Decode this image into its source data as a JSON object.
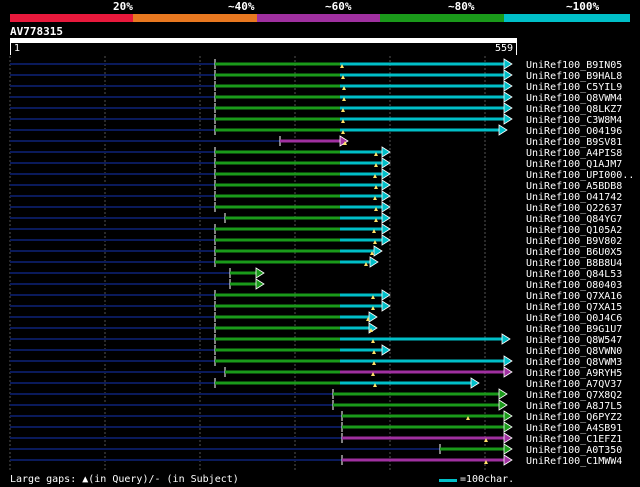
{
  "legend": {
    "colors": [
      "#e8193c",
      "#e87820",
      "#a030a0",
      "#1a9a1a",
      "#00bfc8"
    ],
    "labels": [
      "20%",
      "~40%",
      "~60%",
      "~80%",
      "~100%"
    ]
  },
  "query": {
    "id": "AV778315",
    "start": "1",
    "end": "559"
  },
  "hits": [
    "UniRef100_B9IN05",
    "UniRef100_B9HAL8",
    "UniRef100_C5YIL9",
    "UniRef100_Q8VWM4",
    "UniRef100_Q8LKZ7",
    "UniRef100_C3W8M4",
    "UniRef100_O04196",
    "UniRef100_B9SV81",
    "UniRef100_A4PIS8",
    "UniRef100_Q1AJM7",
    "UniRef100_UPI000..",
    "UniRef100_A5BDB8",
    "UniRef100_O41742",
    "UniRef100_Q22637",
    "UniRef100_Q84YG7",
    "UniRef100_Q105A2",
    "UniRef100_B9V802",
    "UniRef100_B6U0X5",
    "UniRef100_B8B8U4",
    "UniRef100_Q84L53",
    "UniRef100_O80403",
    "UniRef100_Q7XA16",
    "UniRef100_Q7XA15",
    "UniRef100_Q0J4C6",
    "UniRef100_B9G1U7",
    "UniRef100_Q8W547",
    "UniRef100_Q8VWN0",
    "UniRef100_Q8VWM3",
    "UniRef100_A9RYH5",
    "UniRef100_A7QV37",
    "UniRef100_Q7X8Q2",
    "UniRef100_A8J7L5",
    "UniRef100_Q6PYZ2",
    "UniRef100_A4SB91",
    "UniRef100_C1EFZ1",
    "UniRef100_A0T350",
    "UniRef100_C1MWW4"
  ],
  "footer": {
    "gaps_label": "Large gaps: ▲(in Query)/- (in Subject)",
    "scale_label": "=100char."
  }
}
